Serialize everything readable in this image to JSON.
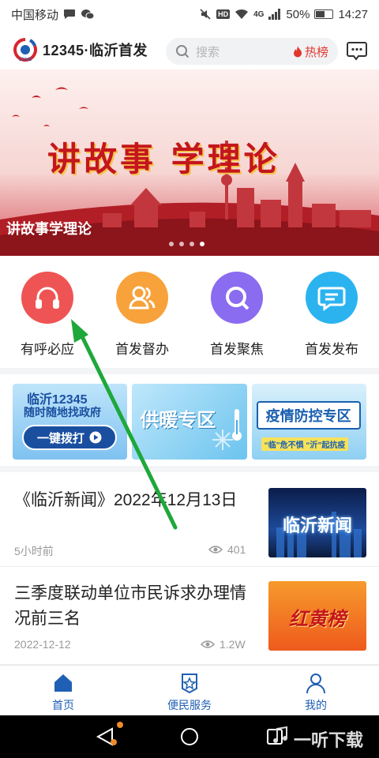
{
  "status": {
    "carrier": "中国移动",
    "network": "4G",
    "battery": "50%",
    "time": "14:27"
  },
  "header": {
    "app_title": "12345·临沂首发",
    "search_placeholder": "搜索",
    "hot_label": "热榜"
  },
  "banner": {
    "headline": "讲故事 学理论",
    "caption": "讲故事学理论",
    "slide_count": 4,
    "active_slide": 4
  },
  "quick_menu": [
    {
      "label": "有呼必应",
      "icon": "headset-icon",
      "color": "#ef5454"
    },
    {
      "label": "首发督办",
      "icon": "people-icon",
      "color": "#f7a23b"
    },
    {
      "label": "首发聚焦",
      "icon": "search-icon",
      "color": "#8a6cf0"
    },
    {
      "label": "首发发布",
      "icon": "message-icon",
      "color": "#2bb3f0"
    }
  ],
  "promo_cards": {
    "hotline": {
      "line1": "临沂12345",
      "line2": "随时随地找政府",
      "button": "一键拨打"
    },
    "heating": {
      "label": "供暖专区"
    },
    "epidemic": {
      "label": "疫情防控专区",
      "slogan": "“临”危不惧 “沂”起抗疫"
    }
  },
  "news": [
    {
      "title": "《临沂新闻》2022年12月13日",
      "time": "5小时前",
      "views": "401",
      "thumb_text": "临沂新闻"
    },
    {
      "title": "三季度联动单位市民诉求办理情况前三名",
      "time": "2022-12-12",
      "views": "1.2W",
      "thumb_text": "红黄榜"
    }
  ],
  "tabs": [
    {
      "label": "首页",
      "active": true
    },
    {
      "label": "便民服务",
      "active": false
    },
    {
      "label": "我的",
      "active": false
    }
  ],
  "watermark": "一听下载",
  "colors": {
    "accent": "#1f5fb4",
    "hot": "#e3362d",
    "annotation_arrow": "#1ea83a"
  }
}
